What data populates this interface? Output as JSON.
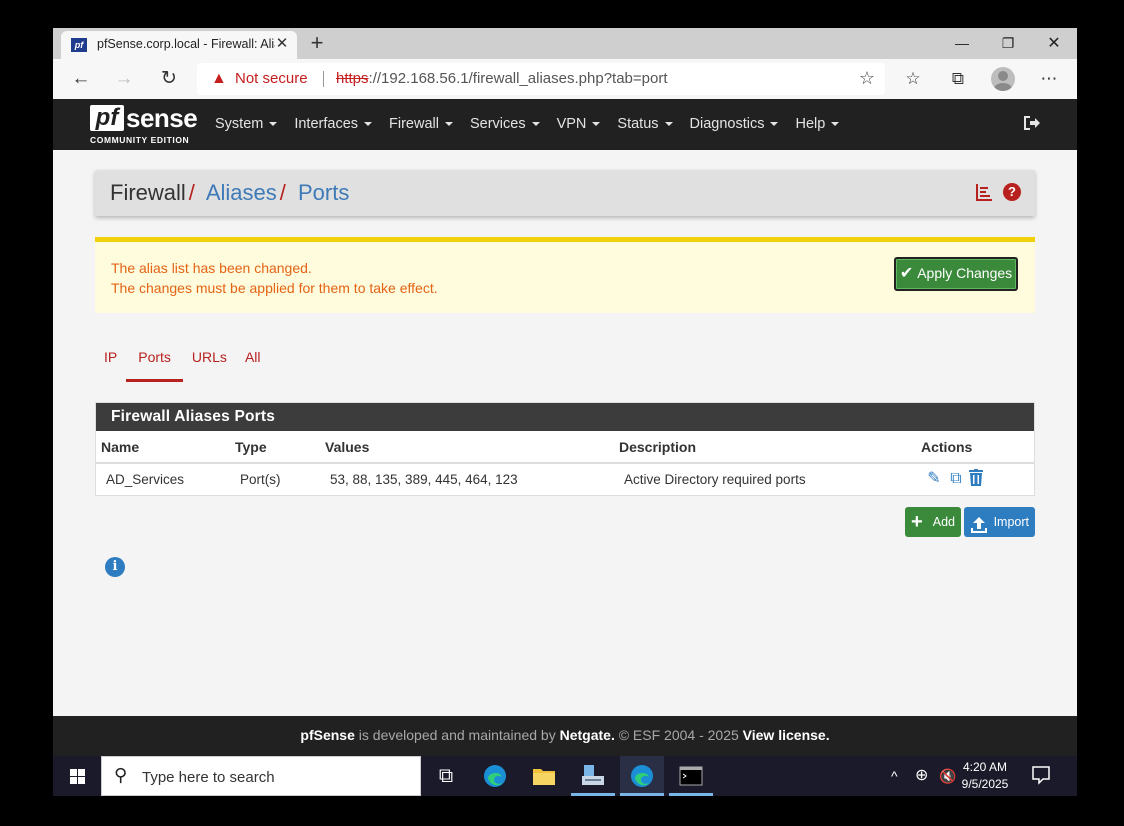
{
  "browser": {
    "tab_title": "pfSense.corp.local - Firewall: Alia",
    "tab_favicon": "pf",
    "security_label": "Not secure",
    "url_scheme": "https",
    "url_rest": "://192.168.56.1/firewall_aliases.php?tab=port"
  },
  "header": {
    "logo_pf": "pf",
    "logo_sense": "sense",
    "logo_edition": "COMMUNITY EDITION",
    "menu": [
      "System",
      "Interfaces",
      "Firewall",
      "Services",
      "VPN",
      "Status",
      "Diagnostics",
      "Help"
    ]
  },
  "breadcrumb": {
    "root": "Firewall",
    "sep": "/",
    "level2": "Aliases",
    "level3": "Ports"
  },
  "alert": {
    "line1": "The alias list has been changed.",
    "line2": "The changes must be applied for them to take effect.",
    "apply_label": "Apply Changes"
  },
  "subtabs": [
    {
      "label": "IP"
    },
    {
      "label": "Ports"
    },
    {
      "label": "URLs"
    },
    {
      "label": "All"
    }
  ],
  "table": {
    "title": "Firewall Aliases Ports",
    "columns": [
      "Name",
      "Type",
      "Values",
      "Description",
      "Actions"
    ],
    "rows": [
      {
        "name": "AD_Services",
        "type": "Port(s)",
        "values": "53, 88, 135, 389, 445, 464, 123",
        "description": "Active Directory required ports"
      }
    ]
  },
  "buttons": {
    "add": "Add",
    "import": "Import"
  },
  "footer": {
    "brand": "pfSense",
    "text1": " is developed and maintained by ",
    "vendor": "Netgate.",
    "text2": " © ESF 2004 - 2025 ",
    "license": "View license."
  },
  "taskbar": {
    "search_placeholder": "Type here to search",
    "time": "4:20 AM",
    "date": "9/5/2025"
  },
  "colors": {
    "accent_red": "#b7221f",
    "link_blue": "#3d7ab8",
    "success_green": "#3b8a3b",
    "alert_orange": "#e36414",
    "header_dark": "#212121"
  }
}
